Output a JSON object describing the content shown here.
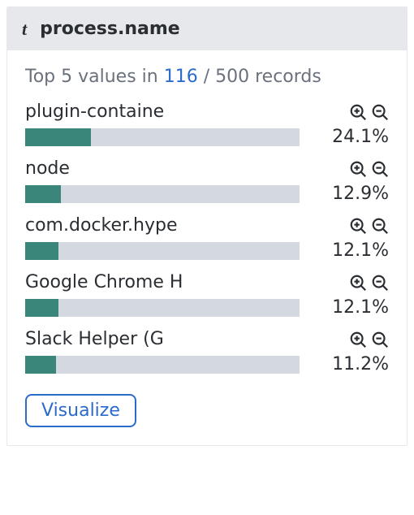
{
  "chart_data": {
    "type": "bar",
    "title": "process.name",
    "categories": [
      "plugin-containe",
      "node",
      "com.docker.hype",
      "Google Chrome H",
      "Slack Helper (G"
    ],
    "values": [
      24.1,
      12.9,
      12.1,
      12.1,
      11.2
    ],
    "xlabel": "",
    "ylabel": "percent",
    "ylim": [
      0,
      100
    ]
  },
  "header": {
    "type_indicator": "t",
    "field_name": "process.name"
  },
  "summary": {
    "prefix": "Top 5 values in ",
    "count": "116",
    "suffix": " / 500 records"
  },
  "rows": [
    {
      "label": "plugin-containe",
      "pct": "24.1%"
    },
    {
      "label": "node",
      "pct": "12.9%"
    },
    {
      "label": "com.docker.hype",
      "pct": "12.1%"
    },
    {
      "label": "Google Chrome H",
      "pct": "12.1%"
    },
    {
      "label": "Slack Helper (G",
      "pct": "11.2%"
    }
  ],
  "buttons": {
    "visualize": "Visualize"
  },
  "colors": {
    "bar_fill": "#3b867a",
    "bar_track": "#d4d9e1",
    "link": "#2b6bcb"
  }
}
